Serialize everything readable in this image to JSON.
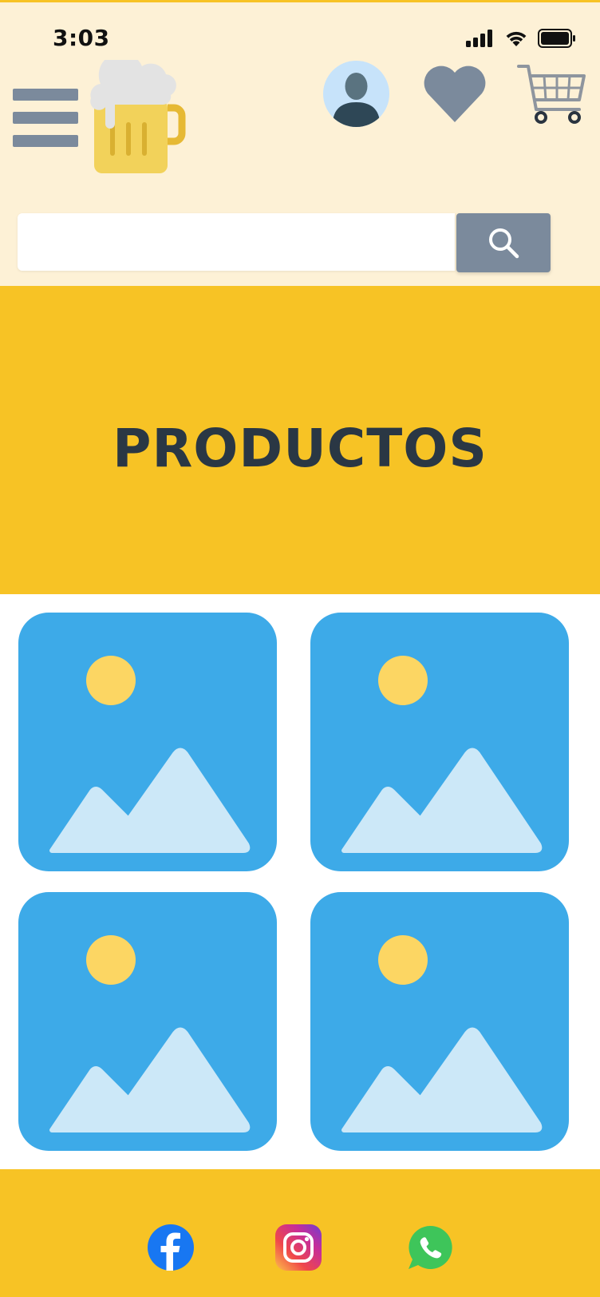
{
  "status_bar": {
    "time": "3:03",
    "icons": [
      "signal-icon",
      "wifi-icon",
      "battery-icon"
    ]
  },
  "header": {
    "menu_icon": "hamburger-menu-icon",
    "logo": "beer-mug-logo",
    "account_icon": "user-avatar-icon",
    "favorites_icon": "heart-icon",
    "cart_icon": "shopping-cart-icon"
  },
  "search": {
    "placeholder": "",
    "value": "",
    "button_icon": "search-icon"
  },
  "banner": {
    "title": "PRODUCTOS"
  },
  "products": [
    {
      "image": "image-placeholder-icon"
    },
    {
      "image": "image-placeholder-icon"
    },
    {
      "image": "image-placeholder-icon"
    },
    {
      "image": "image-placeholder-icon"
    }
  ],
  "footer": {
    "social": [
      "facebook-icon",
      "instagram-icon",
      "whatsapp-icon"
    ]
  },
  "colors": {
    "header_bg": "#fdf1d6",
    "accent": "#f7c325",
    "title_text": "#2a3744",
    "icon_gray": "#7b8a9c",
    "card_blue": "#3daae8"
  }
}
